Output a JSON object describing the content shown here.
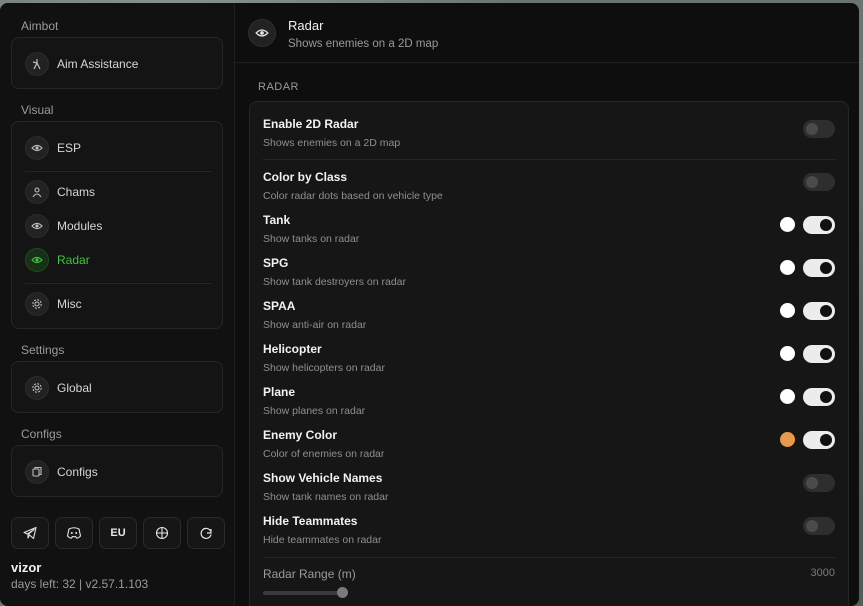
{
  "sidebar": {
    "sections": {
      "aimbot": "Aimbot",
      "visual": "Visual",
      "settings": "Settings",
      "configs": "Configs"
    },
    "items": {
      "aim_assistance": "Aim Assistance",
      "esp": "ESP",
      "chams": "Chams",
      "modules": "Modules",
      "radar": "Radar",
      "misc": "Misc",
      "global": "Global",
      "configs": "Configs"
    },
    "bottom_buttons": {
      "telegram": "telegram-icon",
      "discord": "discord-icon",
      "region": "EU",
      "globe": "globe-icon",
      "refresh": "refresh-icon"
    },
    "user": {
      "name": "vizor",
      "meta": "days left: 32 | v2.57.1.103"
    }
  },
  "header": {
    "title": "Radar",
    "subtitle": "Shows enemies on a 2D map"
  },
  "section_label": "RADAR",
  "settings": [
    {
      "title": "Enable 2D Radar",
      "desc": "Shows enemies on a 2D map",
      "on": false,
      "swatch": null
    },
    {
      "title": "Color by Class",
      "desc": "Color radar dots based on vehicle type",
      "on": false,
      "swatch": null
    },
    {
      "title": "Tank",
      "desc": "Show tanks on radar",
      "on": true,
      "swatch": "#ffffff"
    },
    {
      "title": "SPG",
      "desc": "Show tank destroyers on radar",
      "on": true,
      "swatch": "#ffffff"
    },
    {
      "title": "SPAA",
      "desc": "Show anti-air on radar",
      "on": true,
      "swatch": "#ffffff"
    },
    {
      "title": "Helicopter",
      "desc": "Show helicopters on radar",
      "on": true,
      "swatch": "#ffffff"
    },
    {
      "title": "Plane",
      "desc": "Show planes on radar",
      "on": true,
      "swatch": "#ffffff"
    },
    {
      "title": "Enemy Color",
      "desc": "Color of enemies on radar",
      "on": true,
      "swatch": "#e89a4a"
    },
    {
      "title": "Show Vehicle Names",
      "desc": "Show tank names on radar",
      "on": false,
      "swatch": null
    },
    {
      "title": "Hide Teammates",
      "desc": "Hide teammates on radar",
      "on": false,
      "swatch": null
    }
  ],
  "slider": {
    "label": "Radar Range (m)",
    "value": "3000"
  },
  "colors": {
    "accent": "#3ec43e",
    "background": "#0e0e0e",
    "panel": "#161616"
  }
}
